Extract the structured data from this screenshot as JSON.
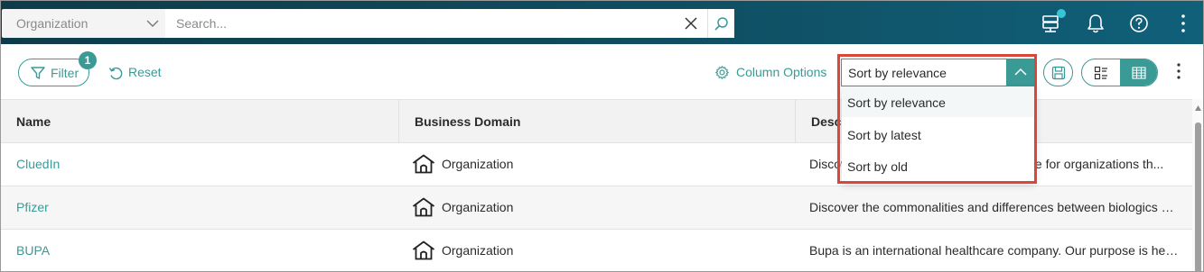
{
  "header": {
    "entity_select": {
      "value": "Organization"
    },
    "search": {
      "placeholder": "Search..."
    },
    "icons": [
      "server-status-icon",
      "bell-icon",
      "help-icon",
      "more-vertical-icon"
    ]
  },
  "toolbar": {
    "filter_label": "Filter",
    "filter_count": "1",
    "reset_label": "Reset",
    "column_options_label": "Column Options",
    "sort": {
      "selected": "Sort by relevance",
      "options": [
        "Sort by relevance",
        "Sort by latest",
        "Sort by old"
      ]
    }
  },
  "table": {
    "columns": [
      "Name",
      "Business Domain",
      "Description"
    ],
    "description_header_visible": "Desc",
    "rows": [
      {
        "name": "CluedIn",
        "domain": "Organization",
        "description": "CluedIn is a cloud-native Master Data Management platform, the choice for organizations th..."
      },
      {
        "name": "Pfizer",
        "domain": "Organization",
        "description": "Discover the commonalities and differences between biologics vs..."
      },
      {
        "name": "BUPA",
        "domain": "Organization",
        "description": "Bupa is an international healthcare company. Our purpose is help..."
      }
    ],
    "row1_visible_left": "Discov",
    "row1_visible_right": "oice for organizations th..."
  },
  "colors": {
    "accent": "#3a9a96",
    "topbar": "#0f4a5c",
    "highlight": "#d9463a"
  }
}
